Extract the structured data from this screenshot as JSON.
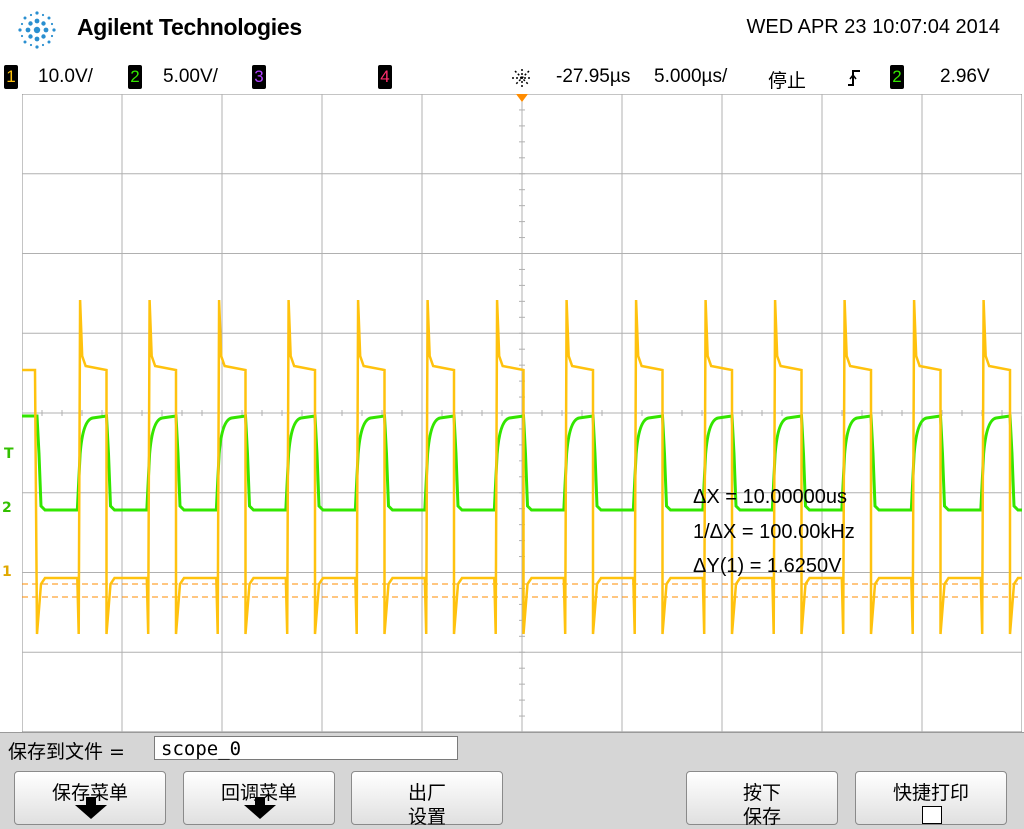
{
  "header": {
    "brand": "Agilent Technologies",
    "datetime": "WED APR 23 10:07:04 2014"
  },
  "status": {
    "ch1": {
      "num": "1",
      "scale": "10.0V/",
      "color": "#ffc20e"
    },
    "ch2": {
      "num": "2",
      "scale": "5.00V/",
      "color": "#33e600"
    },
    "ch3": {
      "num": "3",
      "color": "#b040ff"
    },
    "ch4": {
      "num": "4",
      "color": "#ff2e6e"
    },
    "delay": "-27.95µs",
    "timebase": "5.000µs/",
    "run_state": "停止",
    "trigger_icon": "rising-edge-icon",
    "trigger_source": "2",
    "trigger_level": "2.96V"
  },
  "display": {
    "background": "#ffffff",
    "grid_color": "#b0b0b0",
    "ch1_color": "#ffc20e",
    "ch2_color": "#33e600",
    "markers": {
      "trigger": "T",
      "ch2": "2",
      "ch1": "1"
    }
  },
  "cursors": {
    "dx": "ΔX = 10.00000us",
    "inv_dx": "1/ΔX = 100.00kHz",
    "dy": "ΔY(1) = 1.6250V"
  },
  "file": {
    "label": "保存到文件 =",
    "value": "scope_0"
  },
  "softkeys": [
    {
      "line1": "保存菜单",
      "line2": "",
      "icon": "down-arrow-icon"
    },
    {
      "line1": "回调菜单",
      "line2": "",
      "icon": "down-arrow-icon"
    },
    {
      "line1": "出厂",
      "line2": "设置",
      "icon": ""
    },
    {
      "line1": "按下",
      "line2": "保存",
      "icon": ""
    },
    {
      "line1": "快捷打印",
      "line2": "",
      "icon": "checkbox-icon"
    }
  ]
}
